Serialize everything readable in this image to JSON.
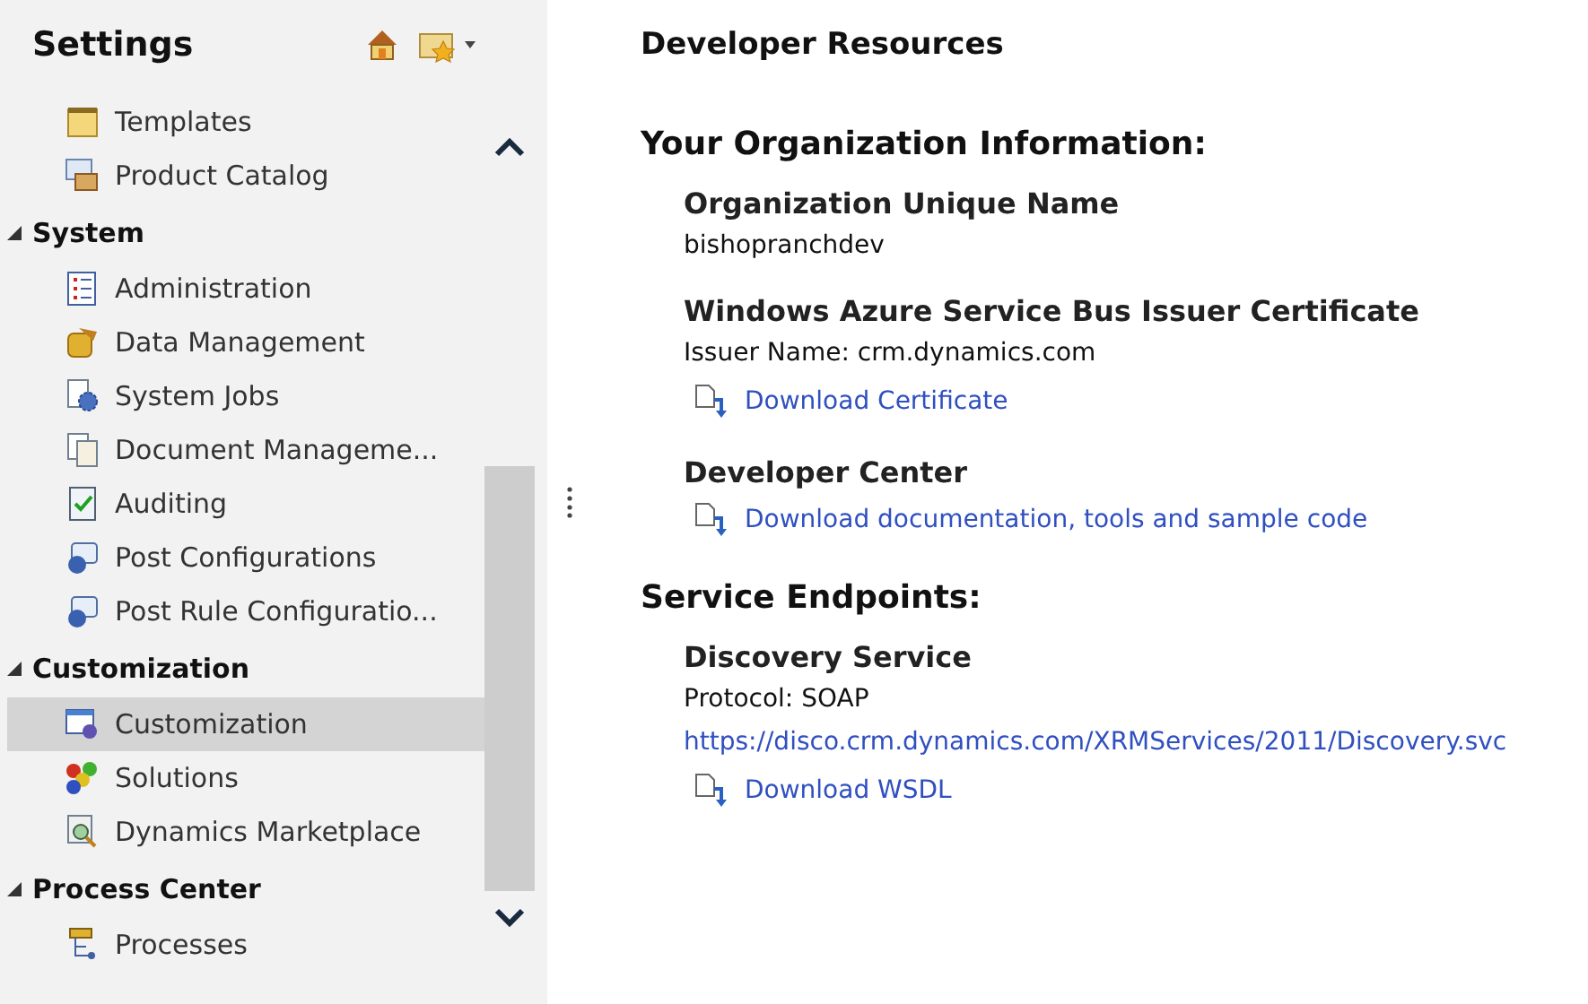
{
  "sidebar": {
    "title": "Settings",
    "sections": [
      {
        "items": [
          {
            "label": "Templates",
            "selected": false
          },
          {
            "label": "Product Catalog",
            "selected": false
          }
        ]
      },
      {
        "label": "System",
        "expanded": true,
        "items": [
          {
            "label": "Administration",
            "selected": false
          },
          {
            "label": "Data Management",
            "selected": false
          },
          {
            "label": "System Jobs",
            "selected": false
          },
          {
            "label": "Document Manageme...",
            "selected": false
          },
          {
            "label": "Auditing",
            "selected": false
          },
          {
            "label": "Post Configurations",
            "selected": false
          },
          {
            "label": "Post Rule Configuratio...",
            "selected": false
          }
        ]
      },
      {
        "label": "Customization",
        "expanded": true,
        "items": [
          {
            "label": "Customization",
            "selected": true
          },
          {
            "label": "Solutions",
            "selected": false
          },
          {
            "label": "Dynamics Marketplace",
            "selected": false
          }
        ]
      },
      {
        "label": "Process Center",
        "expanded": true,
        "items": [
          {
            "label": "Processes",
            "selected": false
          }
        ]
      }
    ]
  },
  "main": {
    "title": "Developer Resources",
    "sections": [
      {
        "heading": "Your Organization Information:",
        "groups": [
          {
            "title": "Organization Unique Name",
            "lines": [
              {
                "kind": "text",
                "text": "bishopranchdev"
              }
            ]
          },
          {
            "title": "Windows Azure Service Bus Issuer Certificate",
            "lines": [
              {
                "kind": "text",
                "text": "Issuer Name: crm.dynamics.com"
              },
              {
                "kind": "download",
                "text": "Download Certificate"
              }
            ]
          },
          {
            "title": "Developer Center",
            "lines": [
              {
                "kind": "download",
                "text": "Download documentation, tools and sample code"
              }
            ]
          }
        ]
      },
      {
        "heading": "Service Endpoints:",
        "groups": [
          {
            "title": "Discovery Service",
            "lines": [
              {
                "kind": "text",
                "text": "Protocol: SOAP"
              },
              {
                "kind": "link",
                "text": "https://disco.crm.dynamics.com/XRMServices/2011/Discovery.svc"
              },
              {
                "kind": "download",
                "text": "Download WSDL"
              }
            ]
          }
        ]
      }
    ]
  }
}
